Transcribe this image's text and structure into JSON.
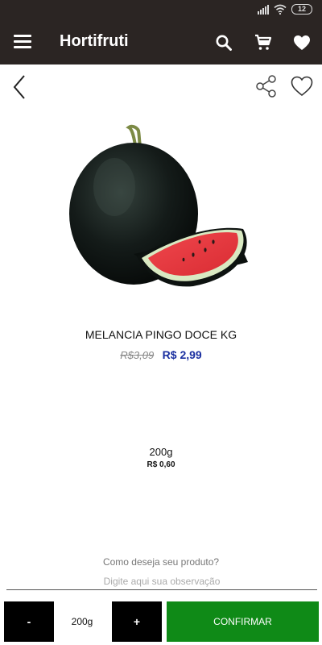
{
  "status_bar": {
    "battery": "12"
  },
  "app_bar": {
    "title": "Hortifruti"
  },
  "product": {
    "name": "MELANCIA PINGO DOCE KG",
    "old_price": "R$3,09",
    "price": "R$ 2,99"
  },
  "selection": {
    "weight": "200g",
    "weight_price": "R$ 0,60"
  },
  "observation": {
    "question": "Como deseja seu produto?",
    "placeholder": "Digite aqui sua observação"
  },
  "bottom_bar": {
    "minus_label": "-",
    "quantity": "200g",
    "plus_label": "+",
    "confirm_label": "CONFIRMAR"
  },
  "colors": {
    "app_bar": "#2b2523",
    "price": "#1a2fa0",
    "confirm": "#0f8a17"
  }
}
